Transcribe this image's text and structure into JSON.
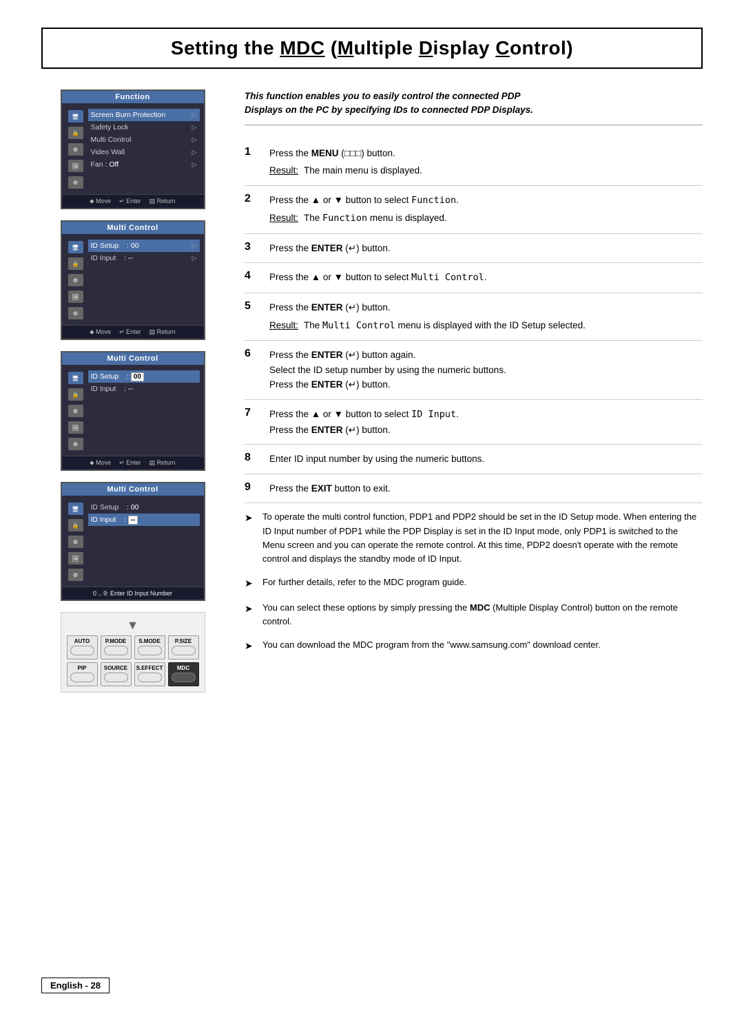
{
  "title": "Setting the MDC (Multiple Display Control)",
  "title_underline": [
    "M",
    "D",
    "C"
  ],
  "intro": "This function enables you to easily control the connected PDP Displays on the PC by specifying IDs to connected PDP Displays.",
  "menus": [
    {
      "id": "menu1",
      "title": "Function",
      "items": [
        {
          "label": "Screen Burn Protection",
          "value": "",
          "arrow": true,
          "highlighted": true
        },
        {
          "label": "Safety Lock",
          "value": "",
          "arrow": true
        },
        {
          "label": "Multi Control",
          "value": "",
          "arrow": true
        },
        {
          "label": "Video Wall",
          "value": "",
          "arrow": true
        },
        {
          "label": "Fan",
          "value": ": Off",
          "arrow": true
        }
      ]
    },
    {
      "id": "menu2",
      "title": "Multi Control",
      "items": [
        {
          "label": "ID Setup",
          "value": ": 00",
          "arrow": true,
          "highlighted": true
        },
        {
          "label": "ID Input",
          "value": ": --",
          "arrow": true
        }
      ]
    },
    {
      "id": "menu3",
      "title": "Multi Control",
      "items": [
        {
          "label": "ID Setup",
          "value": ": 00",
          "arrow": false,
          "highlighted": true,
          "boxed": true
        },
        {
          "label": "ID Input",
          "value": ": --",
          "arrow": false
        }
      ]
    },
    {
      "id": "menu4",
      "title": "Multi Control",
      "items": [
        {
          "label": "ID Setup",
          "value": ": 00",
          "arrow": false,
          "highlighted": false
        },
        {
          "label": "ID Input",
          "value": ": --",
          "arrow": false,
          "highlighted": true,
          "boxed": true
        }
      ],
      "footer_note": "0 .. 9: Enter ID Input Number"
    }
  ],
  "steps": [
    {
      "num": "1",
      "text": "Press the MENU (□□□) button.",
      "result_label": "Result:",
      "result_text": "The main menu is displayed."
    },
    {
      "num": "2",
      "text": "Press the ▲ or ▼ button to select Function.",
      "result_label": "Result:",
      "result_text": "The Function menu is displayed."
    },
    {
      "num": "3",
      "text": "Press the ENTER (↵) button."
    },
    {
      "num": "4",
      "text": "Press the ▲ or ▼ button to select Multi Control."
    },
    {
      "num": "5",
      "text": "Press the ENTER (↵) button.",
      "result_label": "Result:",
      "result_text": "The Multi Control menu is displayed with the ID Setup selected."
    },
    {
      "num": "6",
      "text": "Press the ENTER (↵) button again.\nSelect the ID setup number by using the numeric buttons.\nPress the ENTER (↵) button."
    },
    {
      "num": "7",
      "text": "Press the ▲ or ▼ button to select ID Input.\nPress the ENTER (↵) button."
    },
    {
      "num": "8",
      "text": "Enter ID input number by using the numeric buttons."
    },
    {
      "num": "9",
      "text": "Press the EXIT button to exit."
    }
  ],
  "notes": [
    "To operate the multi control function, PDP1 and PDP2 should be set in the ID Setup mode. When entering the ID Input number of PDP1 while the PDP Display is set in the ID Input mode, only PDP1 is switched to the Menu screen and you can operate the remote control. At this time, PDP2 doesn't operate with the remote control and displays the standby mode of ID Input.",
    "For further details, refer to the MDC program guide.",
    "You can select these options by simply pressing the MDC (Multiple Display Control) button on the remote control.",
    "You can download the MDC program from the \"www.samsung.com\" download center."
  ],
  "remote": {
    "row1_labels": [
      "AUTO",
      "P.MODE",
      "S.MODE",
      "P.SIZE"
    ],
    "row2_labels": [
      "PIP",
      "SOURCE",
      "S.EFFECT",
      "MDC"
    ]
  },
  "footer": "English - 28"
}
